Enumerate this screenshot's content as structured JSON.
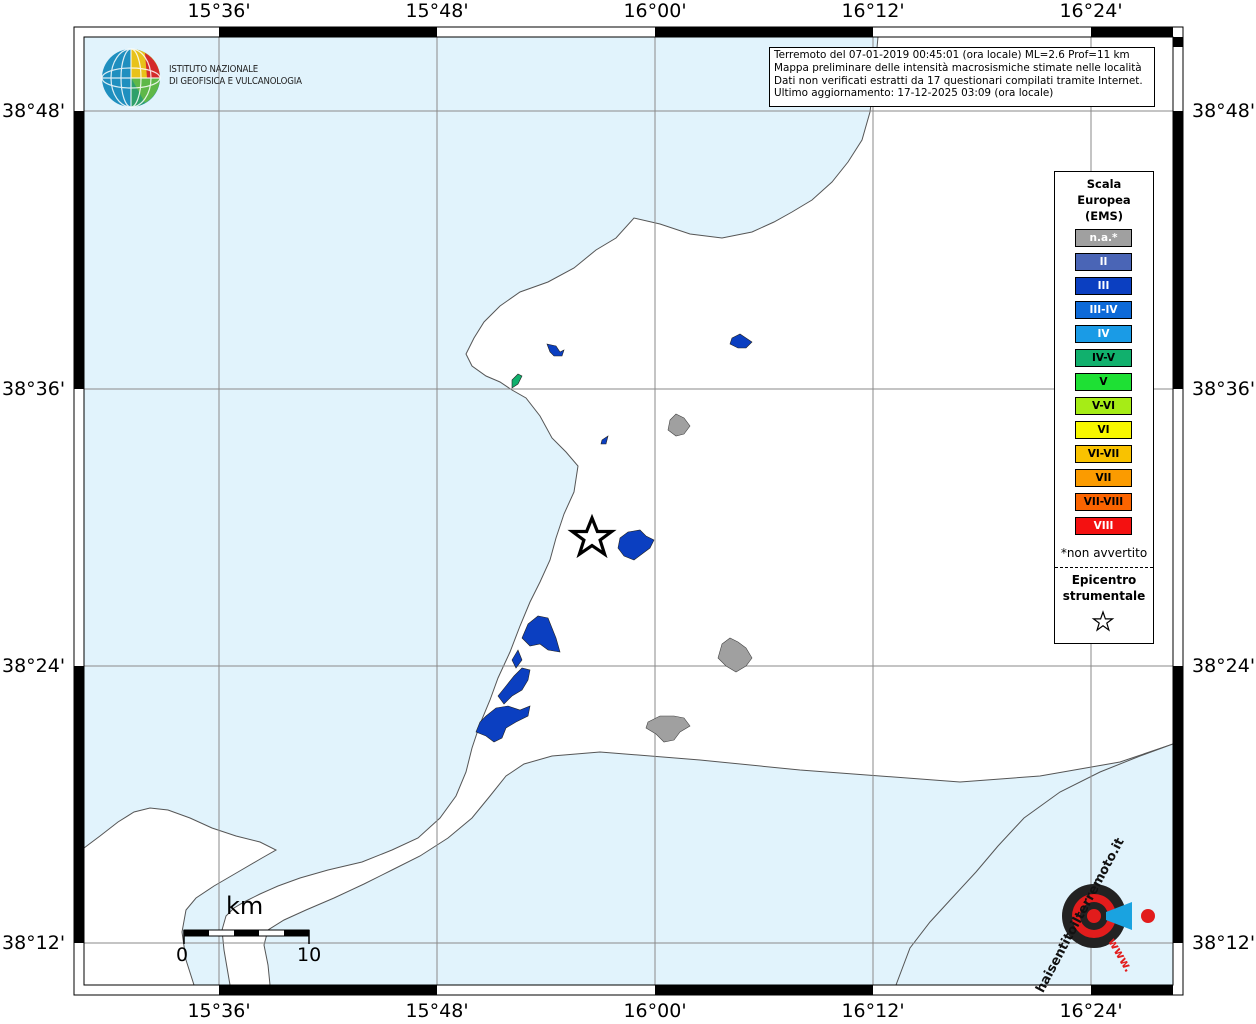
{
  "map": {
    "lon_labels": [
      "15°36'",
      "15°48'",
      "16°00'",
      "16°12'",
      "16°24'"
    ],
    "lat_labels": [
      "38°48'",
      "38°36'",
      "38°24'",
      "38°12'"
    ],
    "colors": {
      "sea": "#e1f3fc",
      "land": "#ffffff",
      "coast": "#555555",
      "grid": "#888888"
    }
  },
  "info": {
    "lines": [
      "Terremoto del 07-01-2019 00:45:01 (ora locale) ML=2.6 Prof=11 km",
      "Mappa preliminare delle intensità macrosismiche stimate nelle località",
      "Dati non verificati estratti da 17 questionari compilati tramite Internet.",
      "Ultimo aggiornamento: 17-12-2025 03:09 (ora locale)"
    ]
  },
  "logo": {
    "line1": "ISTITUTO NAZIONALE",
    "line2": "DI GEOFISICA E VULCANOLOGIA",
    "icon": "ingv-globe-icon"
  },
  "legend": {
    "title": [
      "Scala",
      "Europea",
      "(EMS)"
    ],
    "items": [
      {
        "label": "n.a.*",
        "color": "#a0a0a0",
        "text": "#ffffff"
      },
      {
        "label": "II",
        "color": "#4a65b6",
        "text": "#ffffff"
      },
      {
        "label": "III",
        "color": "#0b3fc1",
        "text": "#ffffff"
      },
      {
        "label": "III-IV",
        "color": "#0d6ad8",
        "text": "#ffffff"
      },
      {
        "label": "IV",
        "color": "#1a9be6",
        "text": "#ffffff"
      },
      {
        "label": "IV-V",
        "color": "#11b06d",
        "text": "#000000"
      },
      {
        "label": "V",
        "color": "#1ee034",
        "text": "#000000"
      },
      {
        "label": "V-VI",
        "color": "#a6ec16",
        "text": "#000000"
      },
      {
        "label": "VI",
        "color": "#f7f700",
        "text": "#000000"
      },
      {
        "label": "VI-VII",
        "color": "#f9c200",
        "text": "#000000"
      },
      {
        "label": "VII",
        "color": "#fb9b00",
        "text": "#000000"
      },
      {
        "label": "VII-VIII",
        "color": "#fb6400",
        "text": "#000000"
      },
      {
        "label": "VIII",
        "color": "#f41111",
        "text": "#ffffff"
      }
    ],
    "na_note": "*non avvertito",
    "epicenter_title": [
      "Epicentro",
      "strumentale"
    ],
    "epicenter_icon": "star-icon"
  },
  "scalebar": {
    "unit": "km",
    "start": "0",
    "end": "10"
  },
  "hsit_logo": {
    "text": "haisentitoilterremoto.it",
    "url_text": "www.",
    "icon": "radar-signal-icon"
  }
}
